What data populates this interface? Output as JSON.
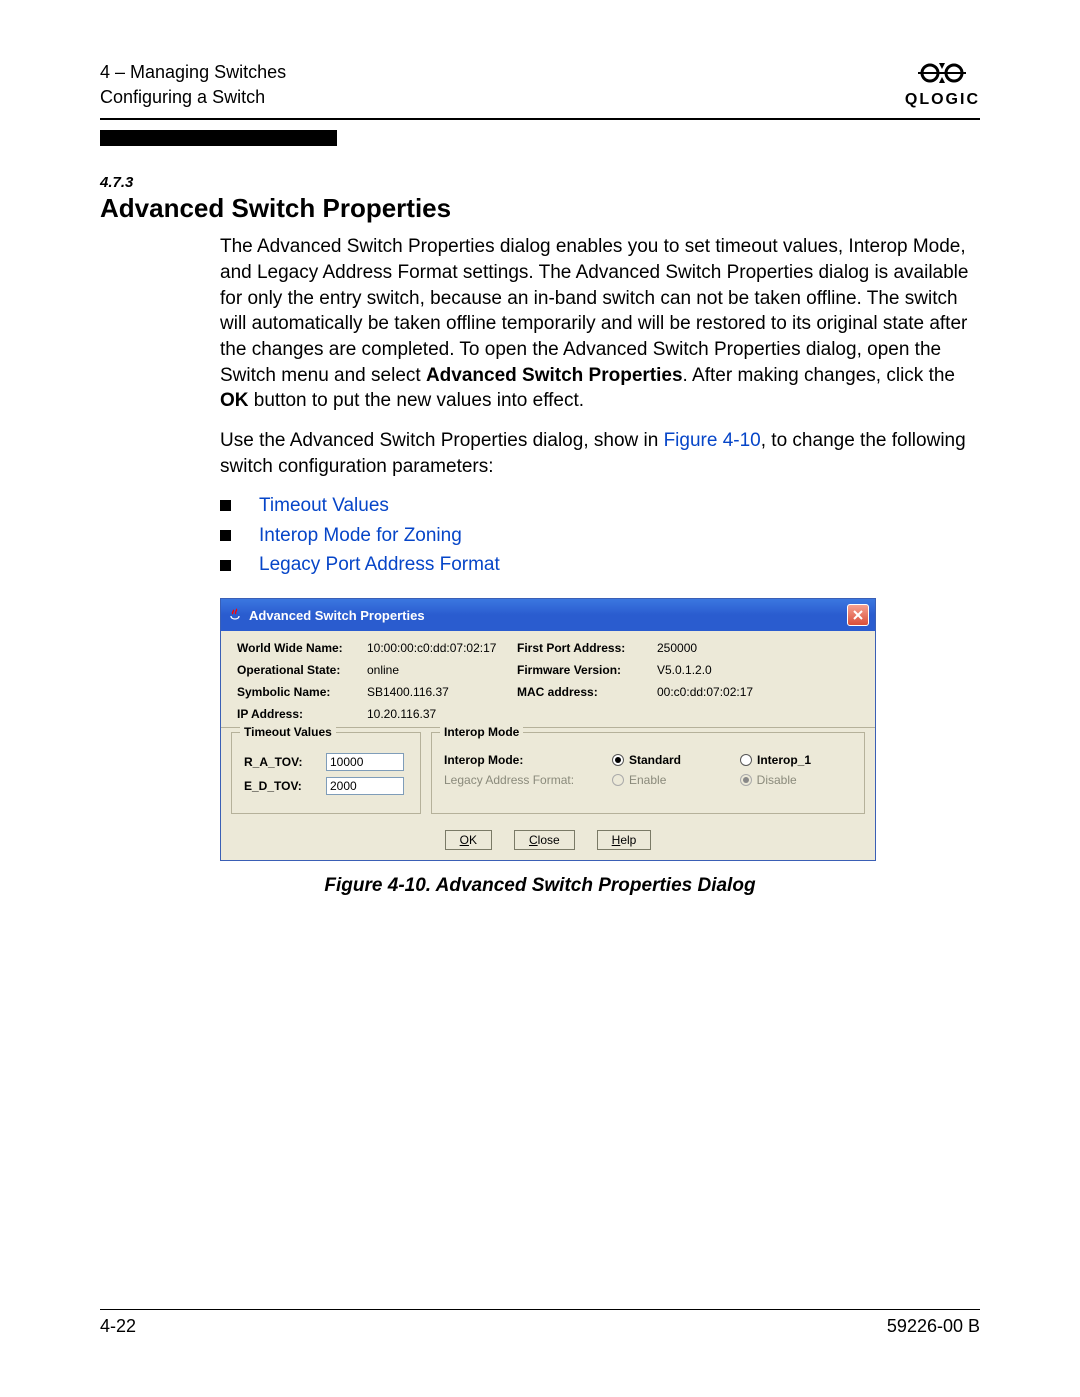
{
  "header": {
    "chapter_line": "4 – Managing Switches",
    "subline": "Configuring a Switch",
    "brand": "QLOGIC"
  },
  "section": {
    "number": "4.7.3",
    "title": "Advanced Switch Properties"
  },
  "para1_a": "The Advanced Switch Properties dialog enables you to set timeout values, Interop Mode, and Legacy Address Format settings. The Advanced Switch Properties dialog is available for only the entry switch, because an in-band switch can not be taken offline. The switch will automatically be taken offline temporarily and will be restored to its original state after the changes are completed. To open the Advanced Switch Properties dialog, open the Switch menu and select ",
  "para1_b1": "Advanced Switch Properties",
  "para1_c": ". After making changes, click the ",
  "para1_b2": "OK",
  "para1_d": " button to put the new values into effect.",
  "para2_a": "Use the Advanced Switch Properties dialog, show in ",
  "para2_ref": "Figure 4-10",
  "para2_b": ", to change the following switch configuration parameters:",
  "bullets": [
    "Timeout Values",
    "Interop Mode for Zoning",
    "Legacy Port Address Format"
  ],
  "dialog": {
    "title": "Advanced Switch Properties",
    "info": {
      "wwn_label": "World Wide Name:",
      "wwn_value": "10:00:00:c0:dd:07:02:17",
      "fpa_label": "First Port Address:",
      "fpa_value": "250000",
      "op_label": "Operational State:",
      "op_value": "online",
      "fw_label": "Firmware Version:",
      "fw_value": "V5.0.1.2.0",
      "sym_label": "Symbolic Name:",
      "sym_value": "SB1400.116.37",
      "mac_label": "MAC address:",
      "mac_value": "00:c0:dd:07:02:17",
      "ip_label": "IP Address:",
      "ip_value": "10.20.116.37"
    },
    "timeout": {
      "legend": "Timeout Values",
      "ra_label": "R_A_TOV:",
      "ra_value": "10000",
      "ed_label": "E_D_TOV:",
      "ed_value": "2000"
    },
    "interop": {
      "legend": "Interop Mode",
      "mode_label": "Interop Mode:",
      "standard": "Standard",
      "interop1": "Interop_1",
      "legacy_label": "Legacy Address Format:",
      "enable": "Enable",
      "disable": "Disable"
    },
    "buttons": {
      "ok": "OK",
      "close": "Close",
      "help": "Help"
    }
  },
  "caption": "Figure 4-10.  Advanced Switch Properties Dialog",
  "footer": {
    "page": "4-22",
    "doc": "59226-00 B"
  }
}
